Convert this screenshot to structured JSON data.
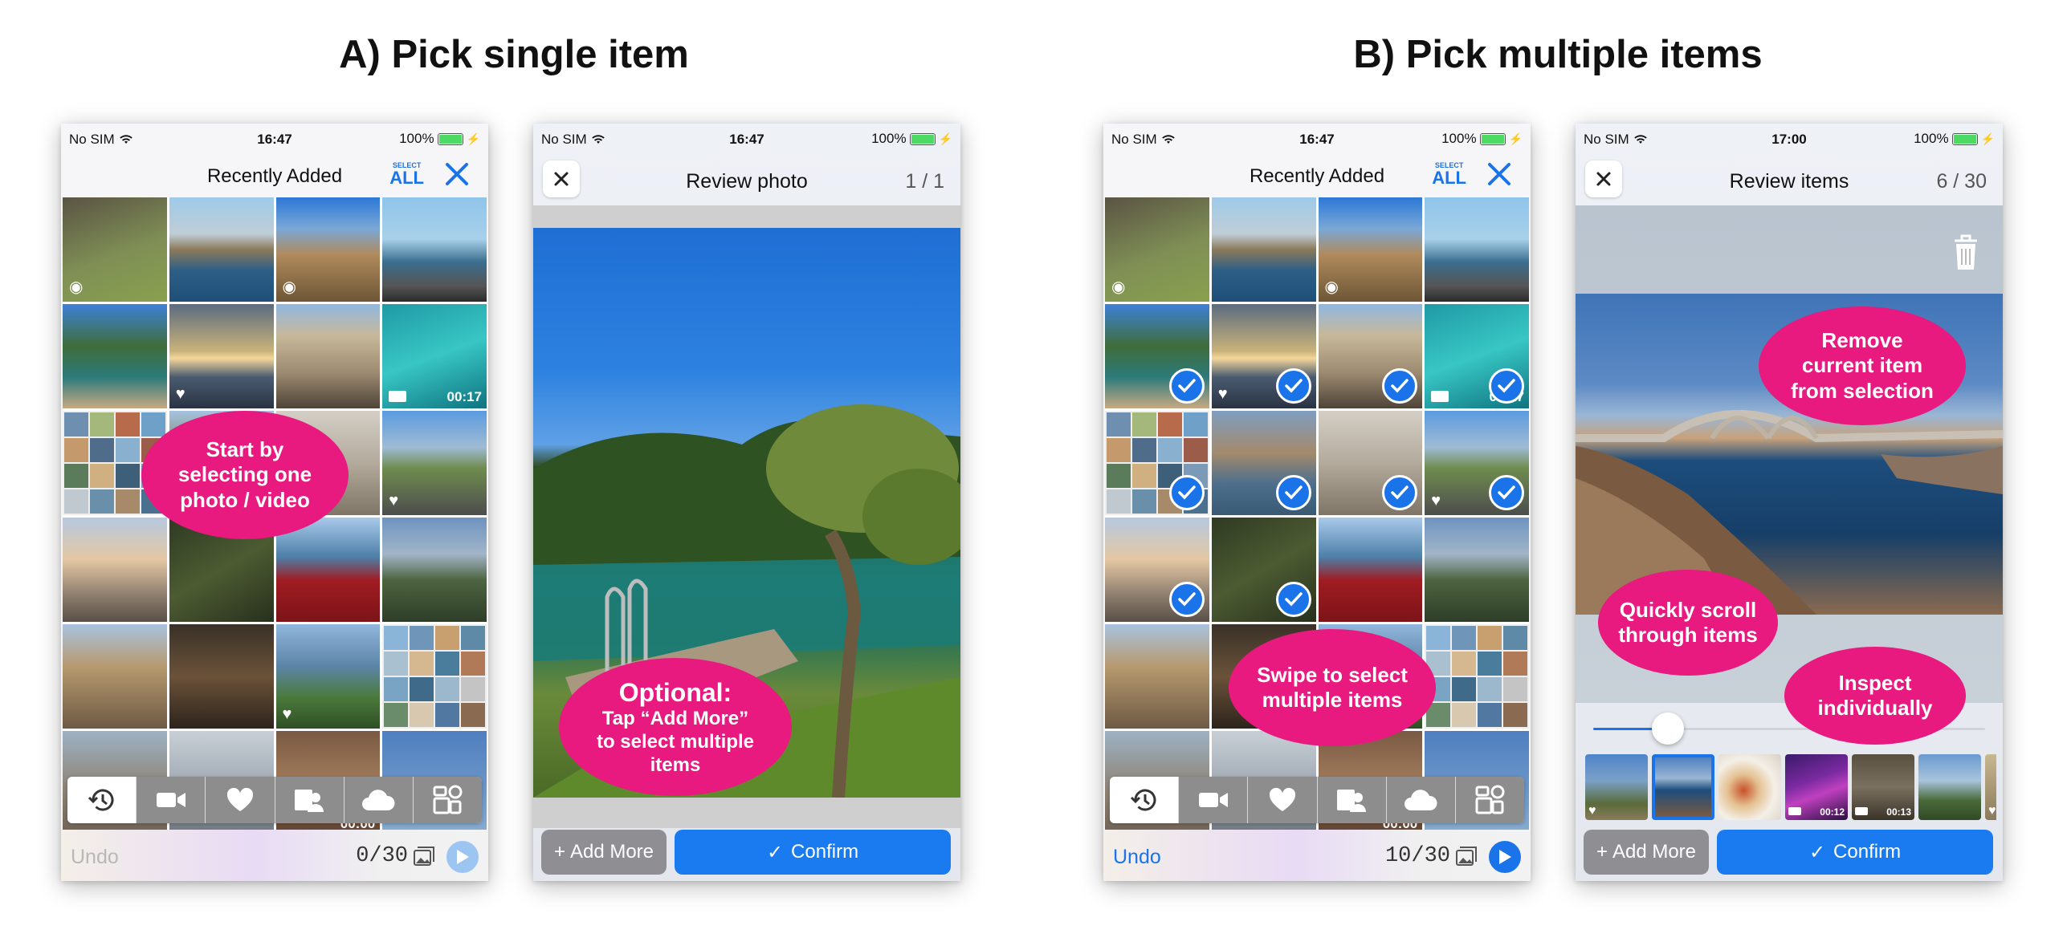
{
  "sections": {
    "a_title": "A) Pick single item",
    "b_title": "B) Pick multiple items"
  },
  "status": {
    "carrier": "No SIM",
    "battery": "100%",
    "time_1": "16:47",
    "time_2": "16:47",
    "time_3": "16:47",
    "time_4": "17:00"
  },
  "picker": {
    "title": "Recently Added",
    "select_all_top": "SELECT",
    "select_all_bottom": "ALL",
    "undo_label": "Undo",
    "counter_a": "0/30",
    "counter_b": "10/30",
    "durations": [
      "00:17",
      "00:00"
    ],
    "toolbar_icons": [
      "history-icon",
      "video-icon",
      "heart-icon",
      "portrait-icon",
      "cloud-icon",
      "library-icon"
    ]
  },
  "review_single": {
    "title": "Review photo",
    "count": "1 / 1",
    "add_more": "Add More",
    "confirm": "Confirm"
  },
  "review_multi": {
    "title": "Review items",
    "count": "6 / 30",
    "add_more": "Add More",
    "confirm": "Confirm",
    "thumb_durations": [
      "00:12",
      "00:13"
    ],
    "scrubber_position": 0.19
  },
  "callouts": {
    "start": [
      "Start by",
      "selecting one",
      "photo / video"
    ],
    "optional_title": "Optional:",
    "optional": [
      "Tap “Add More”",
      "to select multiple",
      "items"
    ],
    "swipe": [
      "Swipe to select",
      "multiple items"
    ],
    "remove": [
      "Remove",
      "current item",
      "from selection"
    ],
    "scroll": [
      "Quickly scroll",
      "through items"
    ],
    "inspect": [
      "Inspect",
      "individually"
    ]
  },
  "colors": {
    "accent": "#1a73e8",
    "callout": "#e8197f",
    "battery": "#4cd964"
  }
}
